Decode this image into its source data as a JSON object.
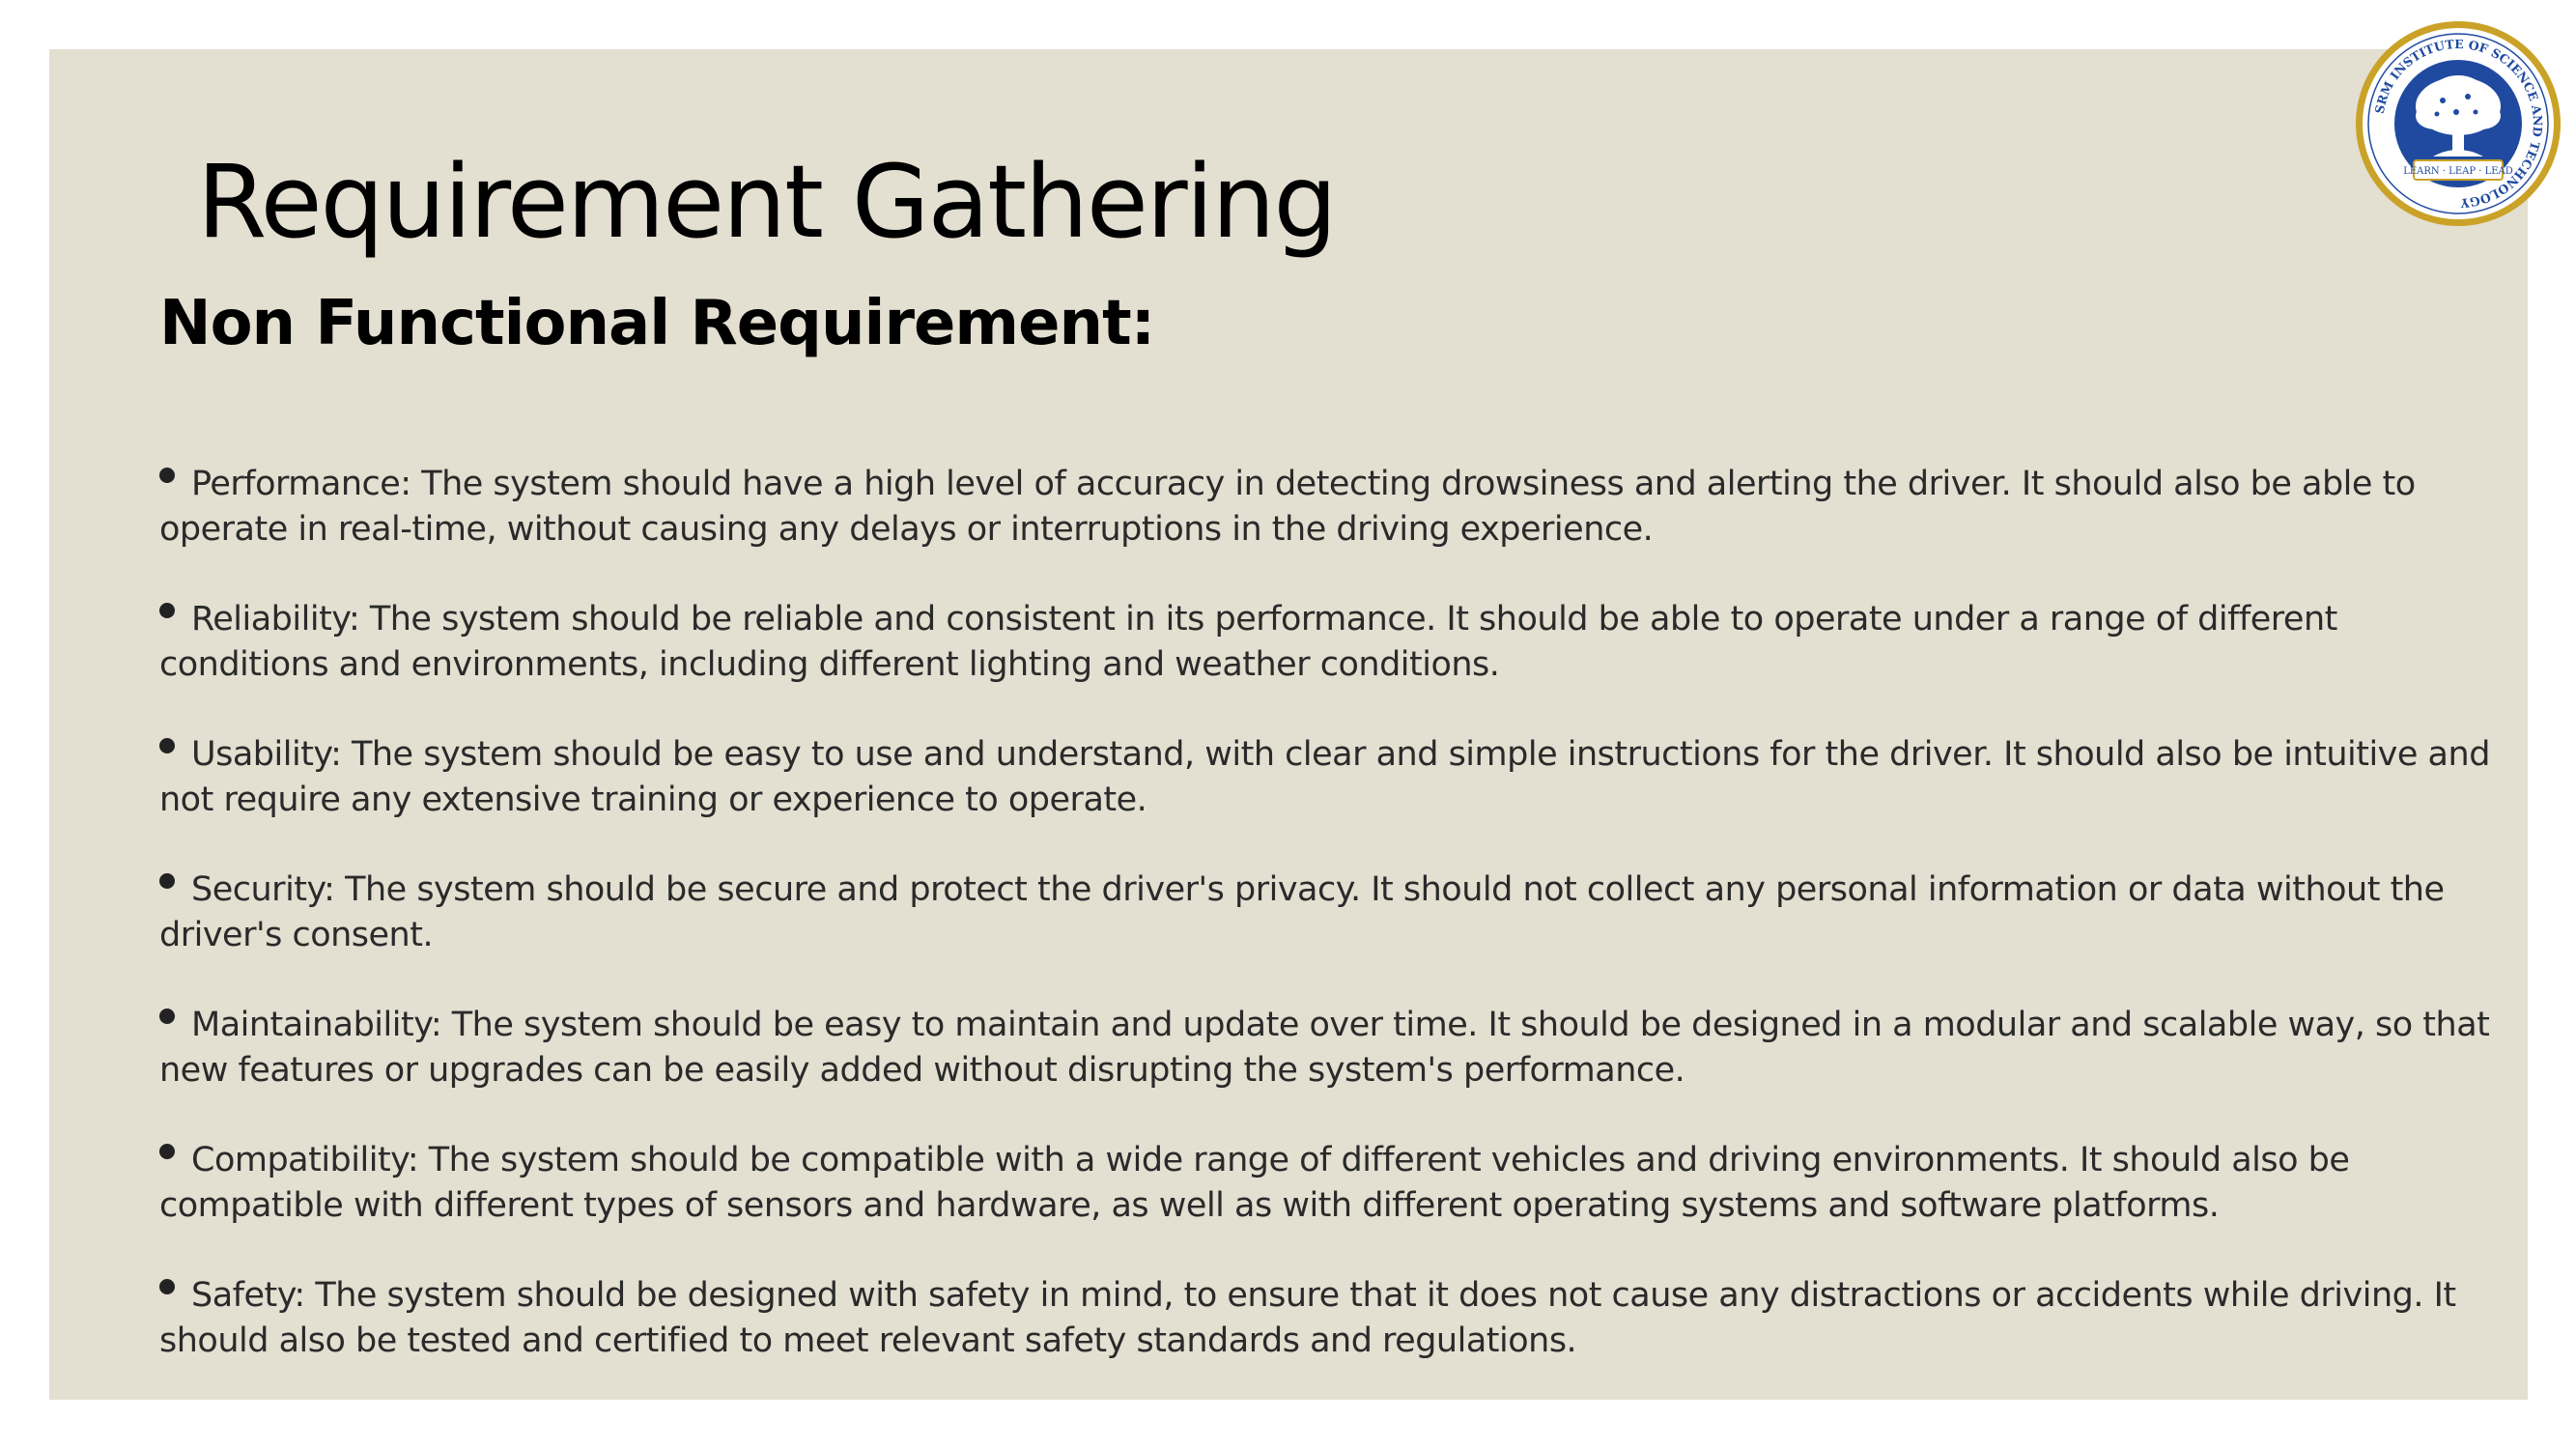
{
  "slide": {
    "title": "Requirement Gathering",
    "subtitle": "Non Functional Requirement:",
    "bullets": [
      "Performance: The system should have a high level of accuracy in detecting drowsiness and alerting the driver. It should also be able to operate in real-time, without causing any delays or interruptions in the driving experience.",
      "Reliability: The system should be reliable and consistent in its performance. It should be able to operate under a range of different conditions and environments, including different lighting and weather conditions.",
      "Usability: The system should be easy to use and understand, with clear and simple instructions for the driver. It should also be intuitive and not require any extensive training or experience to operate.",
      "Security: The system should be secure and protect the driver's privacy. It should not collect any personal information or data without the driver's consent.",
      "Maintainability: The system should be easy to maintain and update over time. It should be designed in a modular and scalable way, so that new features or upgrades can be easily added without disrupting the system's performance.",
      "Compatibility: The system should be compatible with a wide range of different vehicles and driving environments. It should also be compatible with different types of sensors and hardware, as well as with different operating systems and software platforms.",
      "Safety: The system should be designed with safety in mind, to ensure that it does not cause any distractions or accidents while driving. It should also be tested and certified to meet relevant safety standards and regulations."
    ]
  },
  "logo": {
    "ring_text": "SRM INSTITUTE OF SCIENCE AND TECHNOLOGY",
    "motto": "LEARN · LEAP · LEAD",
    "colors": {
      "gold": "#c9a227",
      "blue": "#1f4aa0",
      "white": "#ffffff"
    }
  },
  "colors": {
    "background": "#ffffff",
    "panel": "#e3dfd1",
    "text": "#2a2a2a",
    "heading": "#000000"
  }
}
